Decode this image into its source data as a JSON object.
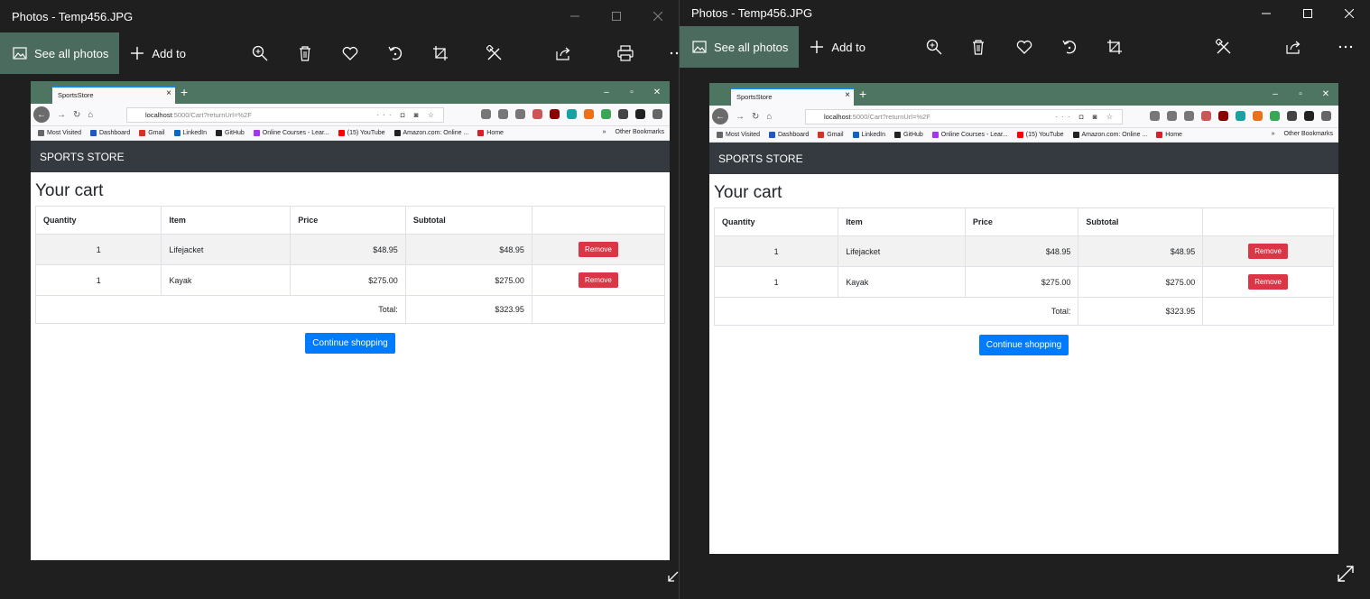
{
  "photos_app": {
    "title": "Photos - Temp456.JPG",
    "see_all_label": "See all photos",
    "add_to_label": "Add to"
  },
  "browser": {
    "tab_title": "SportsStore",
    "url_host": "localhost",
    "url_path": ":5000/Cart?returnUrl=%2F",
    "bookmarks": [
      {
        "label": "Most Visited",
        "color": "#666666"
      },
      {
        "label": "Dashboard",
        "color": "#1f57c3"
      },
      {
        "label": "Gmail",
        "color": "#d93025"
      },
      {
        "label": "LinkedIn",
        "color": "#0a66c2"
      },
      {
        "label": "GitHub",
        "color": "#222222"
      },
      {
        "label": "Online Courses - Lear...",
        "color": "#a435f0"
      },
      {
        "label": "(15) YouTube",
        "color": "#ff0000"
      },
      {
        "label": "Amazon.com: Online ...",
        "color": "#222222"
      },
      {
        "label": "Home",
        "color": "#d6202a"
      }
    ],
    "other_bookmarks": "Other Bookmarks"
  },
  "store": {
    "brand": "SPORTS STORE",
    "heading": "Your cart",
    "headers": {
      "quantity": "Quantity",
      "item": "Item",
      "price": "Price",
      "subtotal": "Subtotal"
    },
    "rows": [
      {
        "quantity": "1",
        "item": "Lifejacket",
        "price": "$48.95",
        "subtotal": "$48.95",
        "action": "Remove"
      },
      {
        "quantity": "1",
        "item": "Kayak",
        "price": "$275.00",
        "subtotal": "$275.00",
        "action": "Remove"
      }
    ],
    "total_label": "Total:",
    "total_value": "$323.95",
    "continue_label": "Continue shopping"
  },
  "colors": {
    "photos_accent": "#4b6b5e",
    "firefox_tabbar": "#4e7462",
    "navbar": "#343a40",
    "remove_button": "#dc3545",
    "continue_button": "#007bff"
  }
}
